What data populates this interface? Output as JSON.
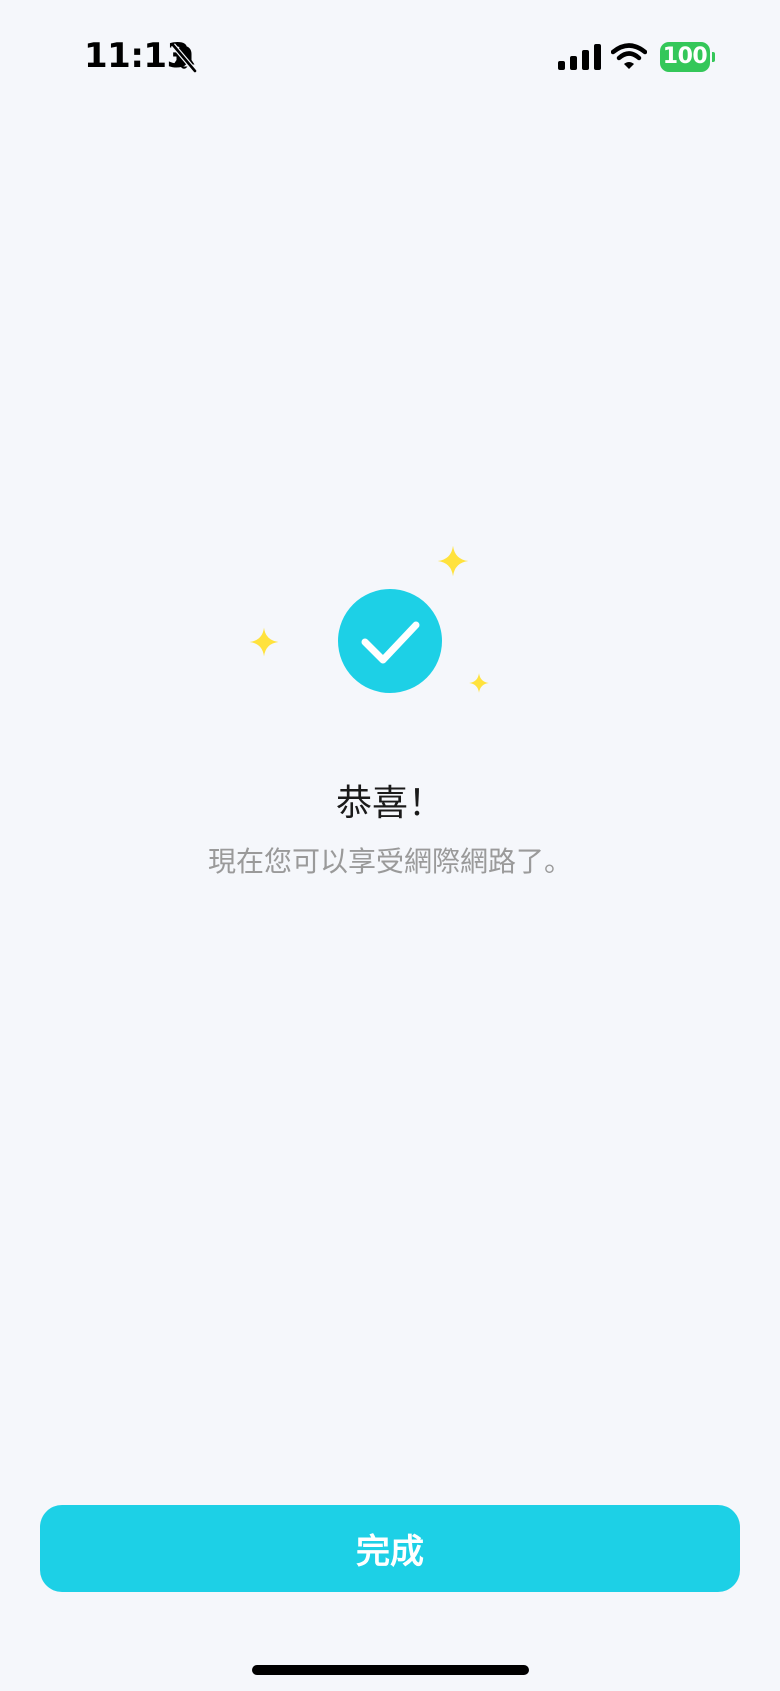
{
  "status_bar": {
    "time": "11:13",
    "battery_level": "100",
    "icons": [
      "bell-slash-icon",
      "cellular-signal-icon",
      "wifi-icon",
      "battery-icon"
    ]
  },
  "success": {
    "icon": "checkmark-icon",
    "decorations": "sparkle-icon",
    "title": "恭喜！",
    "message": "現在您可以享受網際網路了。"
  },
  "actions": {
    "done_label": "完成"
  },
  "colors": {
    "accent": "#1dd0e6",
    "background": "#f5f7fb",
    "sparkle": "#ffe23d",
    "battery": "#34c759",
    "title_text": "#1a1a1a",
    "message_text": "#9a9a9a"
  }
}
